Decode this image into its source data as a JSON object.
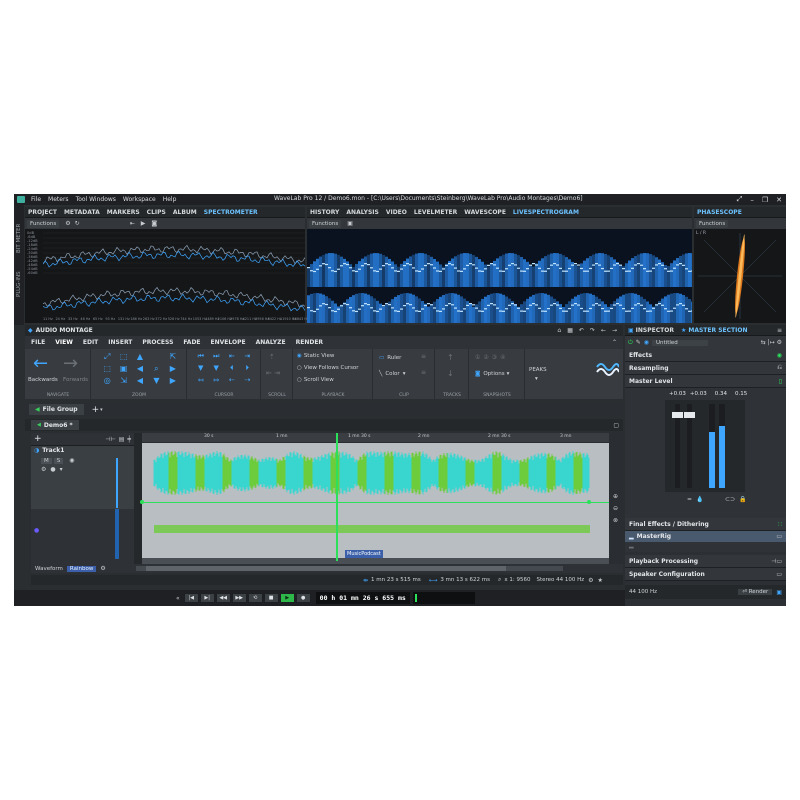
{
  "menubar": {
    "items": [
      "File",
      "Meters",
      "Tool Windows",
      "Workspace",
      "Help"
    ],
    "title": "WaveLab Pro 12 / Demo6.mon - [C:\\Users\\Documents\\Steinberg\\WaveLab Pro\\Audio Montages\\Demo6]"
  },
  "side_strip": {
    "label1": "BIT METER",
    "label2": "PLUG-INS"
  },
  "top_left_tabs": [
    "PROJECT",
    "METADATA",
    "MARKERS",
    "CLIPS",
    "ALBUM",
    "SPECTROMETER"
  ],
  "top_mid_tabs": [
    "HISTORY",
    "ANALYSIS",
    "VIDEO",
    "LEVELMETER",
    "WAVESCOPE",
    "LIVESPECTROGRAM"
  ],
  "top_right_tabs": [
    "PHASESCOPE"
  ],
  "functions_label": "Functions",
  "spectro": {
    "db_labels": [
      "0dB",
      "-6dB",
      "-12dB",
      "-18dB",
      "-24dB",
      "-30dB",
      "-36dB",
      "-42dB",
      "-48dB",
      "-54dB",
      "-60dB"
    ],
    "freq_labels": [
      "11 Hz",
      "24 Hz",
      "33 Hz",
      "46 Hz",
      "65 Hz",
      "93 Hz",
      "131 Hz",
      "186 Hz",
      "263 Hz",
      "372 Hz",
      "526 Hz",
      "744 Hz",
      "1053 Hz",
      "1489 Hz",
      "2106 Hz",
      "2978 Hz",
      "4211 Hz",
      "5956 Hz",
      "8422 Hz",
      "11910 Hz",
      "16843 Hz"
    ]
  },
  "phasescope": {
    "label": "L / R"
  },
  "montage": {
    "title": "AUDIO MONTAGE",
    "ribbon_tabs": [
      "FILE",
      "VIEW",
      "EDIT",
      "INSERT",
      "PROCESS",
      "FADE",
      "ENVELOPE",
      "ANALYZE",
      "RENDER"
    ],
    "navigate": {
      "back": "Backwards",
      "forward": "Forwards",
      "label": "NAVIGATE"
    },
    "groups": [
      "ZOOM",
      "CURSOR",
      "SCROLL",
      "PLAYBACK",
      "CLIP",
      "TRACKS",
      "SNAPSHOTS",
      "PEAKS"
    ],
    "playback": {
      "opt1": "Static View",
      "opt2": "View Follows Cursor",
      "opt3": "Scroll View"
    },
    "clip": {
      "ruler": "Ruler",
      "color": "Color"
    },
    "snapshots": {
      "options": "Options"
    },
    "peaks": "PEAKS",
    "file_group": "File Group",
    "doc_tab": "Demo6 *",
    "track_name": "Track1",
    "track_buttons": [
      "M",
      "S"
    ],
    "clip_name": "MusicPodcast",
    "view_mode": "Waveform",
    "view_style": "Rainbow",
    "ruler_marks": [
      "30 s",
      "1 mn",
      "1 mn 30 s",
      "2 mn",
      "2 mn 30 s",
      "3 mn"
    ],
    "status": {
      "cursor": "1 mn 23 s 515 ms",
      "length": "3 mn 13 s 622 ms",
      "zoom": "x 1: 9560",
      "format": "Stereo 44 100 Hz"
    }
  },
  "transport": {
    "time": "00 h 01 mn 26 s 655 ms"
  },
  "inspector": {
    "tabs": [
      "INSPECTOR",
      "MASTER SECTION"
    ],
    "preset": "Untitled",
    "sections": [
      "Effects",
      "Resampling",
      "Master Level"
    ],
    "levels": [
      "+0.03",
      "+0.03",
      "0.34",
      "0.15"
    ],
    "final_effects": "Final Effects / Dithering",
    "master_rig": "MasterRig",
    "playback_processing": "Playback Processing",
    "speaker_config": "Speaker Configuration",
    "sample_rate": "44 100 Hz",
    "render": "Render"
  },
  "colors": {
    "accent": "#3fa6ff",
    "wave_cyan": "#39d6cf",
    "wave_green": "#6dcc3c",
    "cursor_green": "#2ce05a",
    "spectrogram": "#1f6fd0",
    "phase_orange": "#ff8a1c"
  }
}
